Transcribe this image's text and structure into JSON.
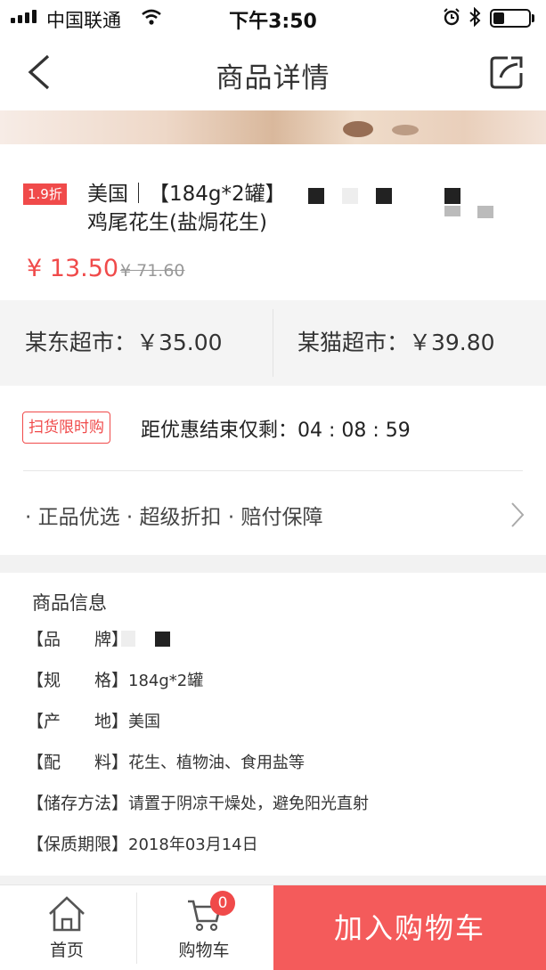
{
  "status_bar": {
    "carrier": "中国联通",
    "time": "下午3:50"
  },
  "nav": {
    "title": "商品详情"
  },
  "product": {
    "discount_badge": "1.9折",
    "name_line1": "美国｜【184g*2罐】",
    "name_line2": "鸡尾花生(盐焗花生)",
    "price": "¥ 13.50",
    "original_price": "¥ 71.60"
  },
  "compare": {
    "store1": "某东超市：￥35.00",
    "store2": "某猫超市：￥39.80"
  },
  "countdown": {
    "tag": "扫货限时购",
    "label": "距优惠结束仅剩：04 : 08 : 59"
  },
  "guarantee": {
    "text": "· 正品优选 · 超级折扣 · 赔付保障"
  },
  "info": {
    "heading": "商品信息",
    "rows": [
      {
        "label": "【品　　牌】",
        "value": ""
      },
      {
        "label": "【规　　格】",
        "value": "184g*2罐"
      },
      {
        "label": "【产　　地】",
        "value": "美国"
      },
      {
        "label": "【配　　料】",
        "value": "花生、植物油、食用盐等"
      },
      {
        "label": "【储存方法】",
        "value": "请置于阴凉干燥处，避免阳光直射"
      },
      {
        "label": "【保质期限】",
        "value": "2018年03月14日"
      }
    ]
  },
  "bottom_bar": {
    "home_label": "首页",
    "cart_label": "购物车",
    "cart_count": "0",
    "add_to_cart": "加入购物车"
  },
  "colors": {
    "accent": "#f04a4a",
    "add_button": "#f45b5b",
    "muted": "#999999",
    "section_bg": "#f4f4f4"
  },
  "icons": [
    "back-arrow-icon",
    "share-icon",
    "chevron-right-icon",
    "home-icon",
    "cart-icon",
    "wifi-icon",
    "alarm-icon",
    "bluetooth-icon",
    "battery-icon"
  ]
}
